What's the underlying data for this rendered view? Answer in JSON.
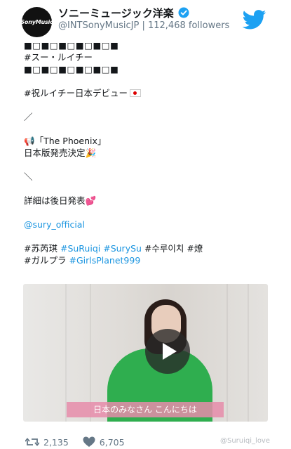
{
  "account": {
    "avatar_text": "SonyMusic",
    "display_name": "ソニーミュージック洋楽",
    "handle": "@INTSonyMusicJP",
    "separator": "|",
    "followers": "112,468 followers"
  },
  "tweet": {
    "lines": [
      "■□■□■□■□■□■",
      "#スー・ルイチー",
      "■□■□■□■□■□■",
      "",
      "#祝ルイチー日本デビュー",
      "",
      "／",
      "",
      "📢「The Phoenix」",
      "日本版発売決定🎉",
      "",
      "＼",
      "",
      "詳細は後日発表💕",
      "",
      "@sury_official",
      "",
      "hashtags1",
      "hashtags2"
    ],
    "mention": "@sury_official",
    "hashtags_row1": [
      {
        "text": "#苏芮琪",
        "link": false
      },
      {
        "text": "#SuRuiqi",
        "link": true
      },
      {
        "text": "#SurySu",
        "link": true
      },
      {
        "text": "#수루이치",
        "link": false
      },
      {
        "text": "#燎",
        "link": false
      }
    ],
    "hashtags_row2": [
      {
        "text": "#ガルプラ",
        "link": false
      },
      {
        "text": "#GirlsPlanet999",
        "link": true
      }
    ]
  },
  "video": {
    "subtitle": "日本のみなさん こんにちは",
    "play_icon": "play-icon"
  },
  "actions": {
    "retweets": "2,135",
    "likes": "6,705"
  },
  "watermark": "@Suruiqi_love",
  "colors": {
    "link": "#1b95e0",
    "twitter_blue": "#1da1f2",
    "meta_gray": "#657786"
  }
}
